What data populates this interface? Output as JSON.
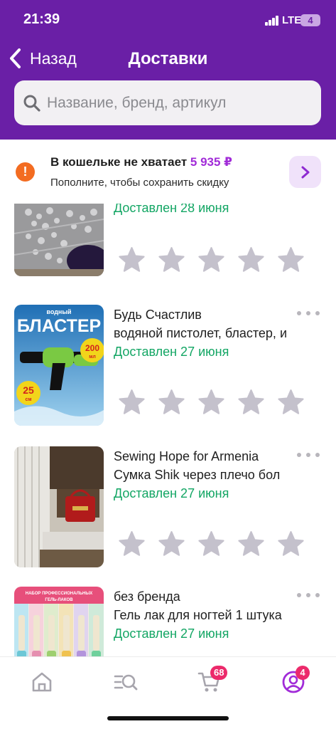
{
  "status_bar": {
    "time": "21:39",
    "network": "LTE",
    "battery": "4"
  },
  "nav": {
    "back_label": "Назад",
    "title": "Доставки"
  },
  "search": {
    "placeholder": "Название, бренд, артикул"
  },
  "wallet_banner": {
    "title": "В кошельке не хватает",
    "amount": "5 935 ₽",
    "subtitle": "Пополните, чтобы сохранить скидку",
    "warning_icon": "!"
  },
  "deliveries": [
    {
      "brand": "",
      "name": "",
      "status": "Доставлен 28 июня",
      "rating": 0,
      "stars_count": 5
    },
    {
      "brand": "Будь Счастлив",
      "name": "водяной пистолет, бластер, и",
      "status": "Доставлен 27 июня",
      "rating": 0,
      "stars_count": 5,
      "image_text": {
        "line1": "водный",
        "line2": "БЛАСТЕР",
        "badge1_value": "200",
        "badge1_unit": "мл",
        "badge2_value": "25",
        "badge2_unit": "см"
      }
    },
    {
      "brand": "Sewing Hope for Armenia",
      "name": "Сумка Shik через плечо бол",
      "status": "Доставлен 27 июня",
      "rating": 0,
      "stars_count": 5
    },
    {
      "brand": "без бренда",
      "name": "Гель лак для ногтей 1 штука",
      "status": "Доставлен 27 июня",
      "rating": 0,
      "stars_count": 5,
      "image_text": {
        "line1": "НАБОР ПРОФЕССИОНАЛЬНЫХ",
        "line2": "ГЕЛЬ-ЛАКОВ"
      }
    }
  ],
  "tabbar": {
    "tabs": [
      {
        "icon": "home-icon"
      },
      {
        "icon": "catalog-search-icon"
      },
      {
        "icon": "cart-icon",
        "badge": "68"
      },
      {
        "icon": "profile-icon",
        "badge": "4"
      }
    ]
  },
  "colors": {
    "header_bg": "#6a1fa6",
    "accent_purple": "#a12bd8",
    "delivered_green": "#13a664",
    "star_gray": "#c4c1cc",
    "badge_pink": "#ec2a6b",
    "warning_orange": "#f36c21"
  }
}
